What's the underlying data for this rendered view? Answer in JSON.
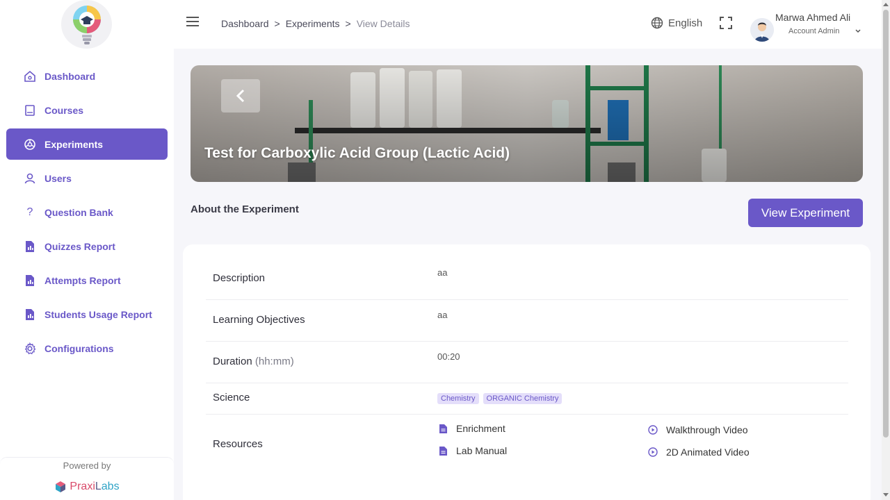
{
  "sidebar": {
    "items": [
      {
        "label": "Dashboard",
        "icon": "home-icon"
      },
      {
        "label": "Courses",
        "icon": "book-icon"
      },
      {
        "label": "Experiments",
        "icon": "experiment-icon",
        "active": true
      },
      {
        "label": "Users",
        "icon": "user-icon"
      },
      {
        "label": "Question Bank",
        "icon": "question-icon"
      },
      {
        "label": "Quizzes Report",
        "icon": "report-icon"
      },
      {
        "label": "Attempts Report",
        "icon": "report-icon"
      },
      {
        "label": "Students Usage Report",
        "icon": "report-icon"
      },
      {
        "label": "Configurations",
        "icon": "gear-icon"
      }
    ],
    "powered_by": "Powered by",
    "brand": {
      "part1": "Praxi",
      "part2": "L",
      "part3": "abs"
    }
  },
  "header": {
    "breadcrumb": [
      "Dashboard",
      ">",
      "Experiments",
      ">",
      "View Details"
    ],
    "language": "English",
    "user_name": "Marwa Ahmed Ali",
    "user_role": "Account Admin"
  },
  "banner": {
    "title": "Test for Carboxylic Acid Group (Lactic Acid)"
  },
  "main": {
    "about_heading": "About the Experiment",
    "view_button": "View Experiment",
    "details": {
      "description_label": "Description",
      "description_value": "aa",
      "objectives_label": "Learning Objectives",
      "objectives_value": "aa",
      "duration_label": "Duration",
      "duration_unit": "(hh:mm)",
      "duration_value": "00:20",
      "science_label": "Science",
      "science_tags": [
        "Chemistry",
        "ORGANIC Chemistry"
      ],
      "resources_label": "Resources",
      "resources": {
        "docs": [
          "Enrichment",
          "Lab Manual"
        ],
        "videos": [
          "Walkthrough Video",
          "2D Animated Video"
        ]
      }
    }
  },
  "colors": {
    "accent": "#6a58c8",
    "tag_bg": "#e4defa",
    "page_bg": "#f6f6fa"
  }
}
